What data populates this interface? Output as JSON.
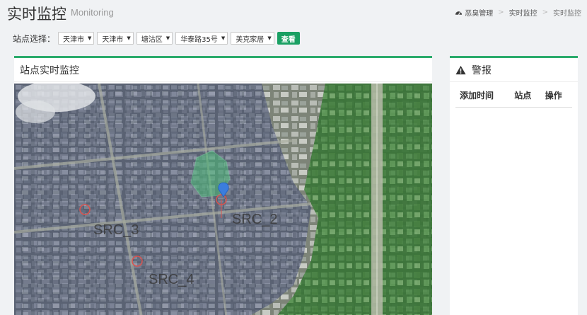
{
  "header": {
    "title": "实时监控",
    "subtitle": "Monitoring"
  },
  "breadcrumb": {
    "items": [
      "恶臭管理",
      "实时监控",
      "实时监控"
    ],
    "separator": ">"
  },
  "filter": {
    "label": "站点选择：",
    "selects": [
      "天津市",
      "天津市",
      "塘沽区",
      "华泰路35号",
      "美克家居"
    ],
    "button": "查看"
  },
  "main_panel": {
    "title": "站点实时监控",
    "sources": [
      {
        "label": "SRC_2"
      },
      {
        "label": "SRC_3"
      },
      {
        "label": "SRC_4"
      }
    ]
  },
  "alert_panel": {
    "title": "警报",
    "columns": [
      "添加时间",
      "站点",
      "操作"
    ]
  },
  "colors": {
    "accent": "#2bab6c",
    "button": "#1aa063",
    "marker": "#d9534f",
    "station": "#3b7ddd"
  }
}
